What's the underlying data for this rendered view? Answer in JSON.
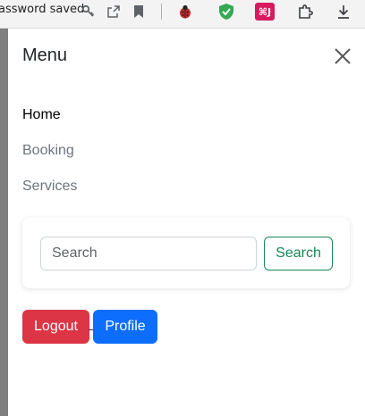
{
  "browser": {
    "password_saved_text": "assword saved",
    "extension_label": "⌘J",
    "colors": {
      "shield": "#34a853",
      "extension": "#d81b60"
    }
  },
  "offcanvas": {
    "title": "Menu",
    "close_icon": "close-icon",
    "nav": [
      {
        "label": "Home",
        "active": true
      },
      {
        "label": "Booking",
        "active": false
      },
      {
        "label": "Services",
        "active": false
      }
    ],
    "search": {
      "placeholder": "Search",
      "value": "",
      "button_label": "Search"
    },
    "buttons": {
      "logout_label": "Logout",
      "profile_label": "Profile"
    },
    "colors": {
      "danger": "#dc3545",
      "primary": "#0d6efd",
      "success": "#198754",
      "nav_muted": "#6c757d"
    }
  }
}
